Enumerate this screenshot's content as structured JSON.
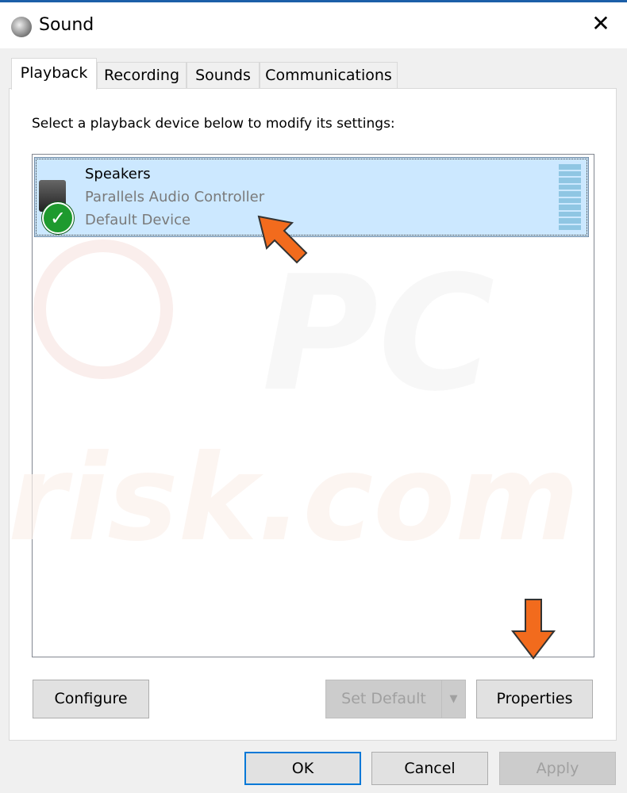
{
  "window": {
    "title": "Sound",
    "icon": "speaker-icon",
    "close_icon": "close-icon",
    "close_glyph": "✕"
  },
  "tabs": [
    {
      "label": "Playback",
      "selected": true
    },
    {
      "label": "Recording"
    },
    {
      "label": "Sounds"
    },
    {
      "label": "Communications"
    }
  ],
  "instruction": "Select a playback device below to modify its settings:",
  "devices": [
    {
      "name": "Speakers",
      "controller": "Parallels Audio Controller",
      "status": "Default Device",
      "selected": true,
      "default_badge": "✓"
    }
  ],
  "buttons": {
    "configure": "Configure",
    "set_default": "Set Default",
    "properties": "Properties",
    "ok": "OK",
    "cancel": "Cancel",
    "apply": "Apply"
  },
  "watermark": "PC risk.com",
  "colors": {
    "selection": "#cce8ff",
    "annotation_arrow": "#f26b1d",
    "default_check": "#1e9a2e"
  }
}
